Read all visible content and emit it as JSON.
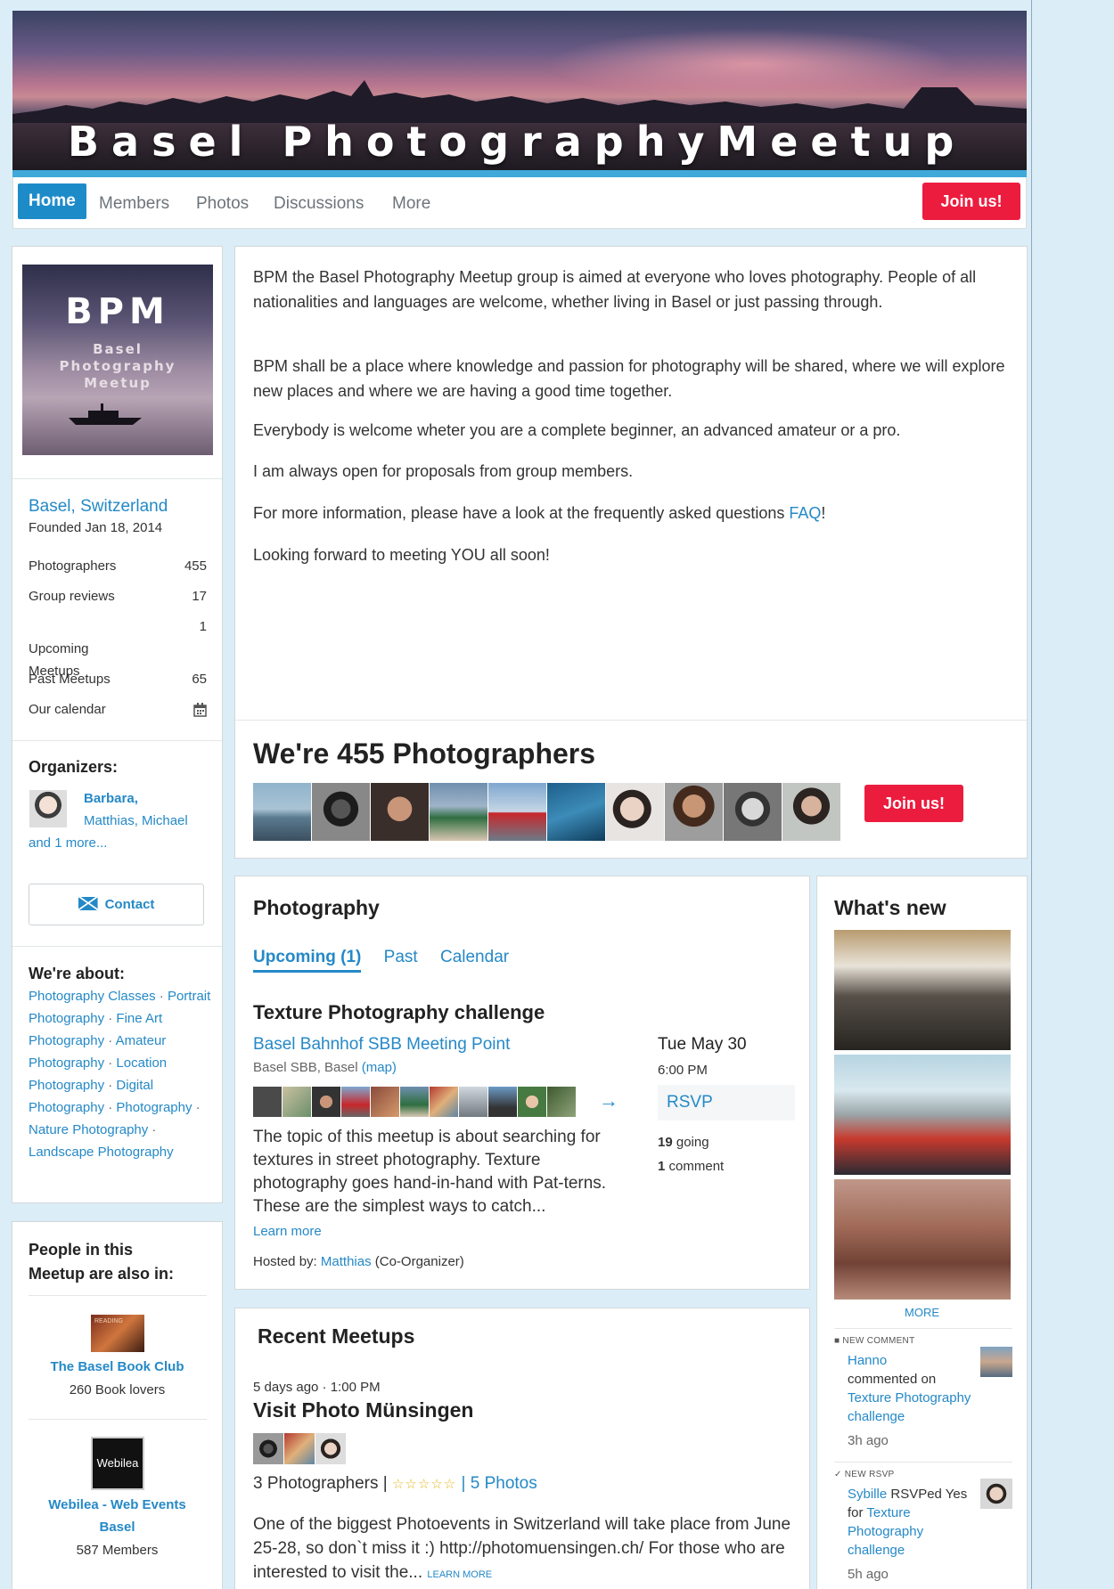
{
  "banner": {
    "title": "Basel PhotographyMeetup"
  },
  "nav": {
    "items": [
      "Home",
      "Members",
      "Photos",
      "Discussions",
      "More"
    ],
    "join_label": "Join us!"
  },
  "sidebar": {
    "logo": {
      "big": "BPM",
      "small": "Basel\nPhotography\nMeetup"
    },
    "location": "Basel, Switzerland",
    "founded": "Founded Jan 18, 2014",
    "stats": [
      {
        "label": "Photographers",
        "value": "455"
      },
      {
        "label": "Group reviews",
        "value": "17"
      },
      {
        "label": "Upcoming\nMeetups",
        "value": "1"
      },
      {
        "label": "Past Meetups",
        "value": "65"
      },
      {
        "label": "Our calendar",
        "value": ""
      }
    ],
    "organizers_title": "Organizers:",
    "organizers": {
      "first": "Barbara,",
      "rest": "Matthias, Michael",
      "more": "and 1 more..."
    },
    "contact_label": "Contact",
    "about_title": "We're about:",
    "topics": [
      "Photography Classes",
      "Portrait Photography",
      "Fine Art Photography",
      "Amateur Photography",
      "Location Photography",
      "Digital Photography",
      "Photography",
      "Nature Photography",
      "Landscape Photography"
    ],
    "people_title": "People in this\nMeetup are also in:",
    "groups": [
      {
        "name": "The Basel Book Club",
        "sub": "260 Book lovers",
        "thumb_text": "READING"
      },
      {
        "name": "Webilea - Web Events Basel",
        "sub": "587 Members",
        "thumb_text": "Webilea"
      }
    ]
  },
  "description": {
    "paragraphs": [
      "BPM the Basel Photography Meetup group is aimed at everyone who loves photography. People of all nationalities and languages are welcome, whether living in Basel or just passing through.",
      "BPM shall be a place where knowledge and passion for photography will be shared, where we will explore new places and where we are having a good time together.",
      "Everybody is welcome wheter you are a complete beginner, an advanced amateur or a pro.",
      "I am always open for proposals from group members.",
      "For more information, please have a look at the frequently asked questions ",
      "Looking forward to meeting YOU all soon!"
    ],
    "faq_link": "FAQ",
    "faq_end": "!",
    "members_heading": "We're 455 Photographers",
    "join_label": "Join us!"
  },
  "events": {
    "heading": "Photography",
    "tabs": [
      "Upcoming (1)",
      "Past",
      "Calendar"
    ],
    "title": "Texture Photography challenge",
    "venue": "Basel Bahnhof SBB Meeting Point",
    "address": "Basel SBB, Basel",
    "map_link": "(map)",
    "description": "The topic of this meetup is about searching for textures in street photography. Texture photography goes hand-in-hand with Pat-terns. These are the simplest ways to catch...",
    "learn_more": "Learn more",
    "hosted_prefix": "Hosted by:",
    "host": "Matthias",
    "host_role": "(Co-Organizer)",
    "date": "Tue May 30",
    "time": "6:00 PM",
    "rsvp_label": "RSVP",
    "going_count": "19",
    "going_label": "going",
    "comment_count": "1",
    "comment_label": "comment",
    "arrow": "→"
  },
  "recent": {
    "heading": "Recent Meetups",
    "meta": "5 days ago · 1:00 PM",
    "title": "Visit Photo Münsingen",
    "attendance": "3 Photographers |",
    "stars": "☆☆☆☆☆",
    "photos_link": "| 5 Photos",
    "description": "One of the biggest Photoevents in Switzerland will take place from June 25-28, so don`t miss it :) http://photomuensingen.ch/ For those who are interested to visit the...",
    "learn_more": "LEARN MORE"
  },
  "whats_new": {
    "heading": "What's new",
    "more_label": "MORE",
    "feed": [
      {
        "label": "NEW COMMENT",
        "who": "Hanno",
        "text": "commented on",
        "target": "Texture Photography challenge",
        "time": "3h ago"
      },
      {
        "label": "NEW RSVP",
        "who": "Sybille",
        "text": "RSVPed Yes for",
        "target": "Texture Photography challenge",
        "time": "5h ago"
      }
    ]
  },
  "colors": {
    "accent": "#2589c7",
    "join": "#ec1c3f",
    "nav_active": "#1e8bc9",
    "page_bg": "#dbedf7"
  }
}
